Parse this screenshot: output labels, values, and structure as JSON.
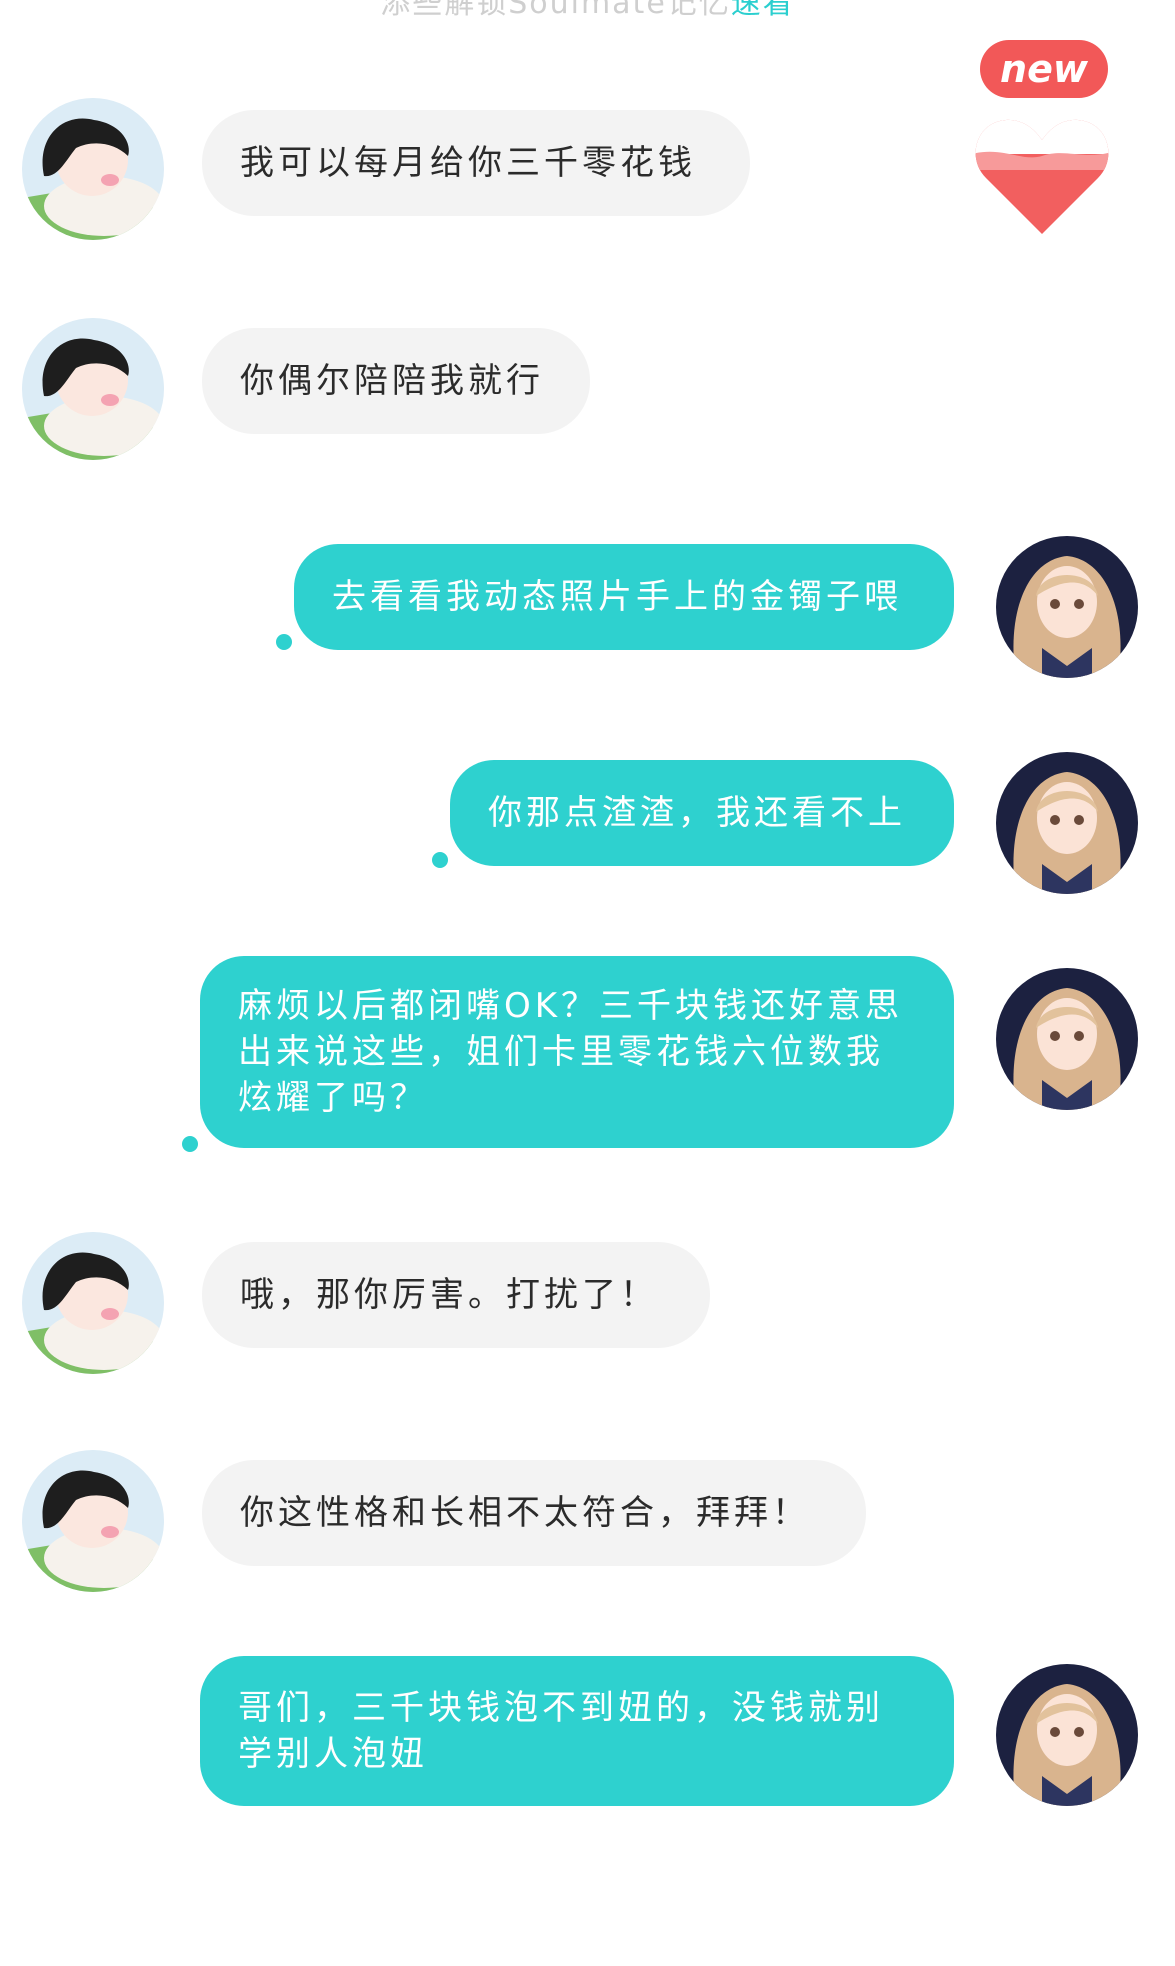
{
  "header": {
    "hint": "添些解锁Soulmate记忆",
    "link": "速看"
  },
  "badge": {
    "label": "new"
  },
  "colors": {
    "accent": "#2ed1cf",
    "bubble_gray": "#f3f3f3",
    "badge": "#f25858"
  },
  "messages": [
    {
      "side": "left",
      "text": "我可以每月给你三千零花钱"
    },
    {
      "side": "left",
      "text": "你偶尔陪陪我就行"
    },
    {
      "side": "right",
      "text": "去看看我动态照片手上的金镯子喂"
    },
    {
      "side": "right",
      "text": "你那点渣渣，我还看不上"
    },
    {
      "side": "right",
      "text": "麻烦以后都闭嘴OK？三千块钱还好意思出来说这些，姐们卡里零花钱六位数我炫耀了吗？"
    },
    {
      "side": "left",
      "text": "哦，那你厉害。打扰了！"
    },
    {
      "side": "left",
      "text": "你这性格和长相不太符合，拜拜！"
    },
    {
      "side": "right",
      "text": "哥们，三千块钱泡不到妞的，没钱就别学别人泡妞"
    }
  ]
}
